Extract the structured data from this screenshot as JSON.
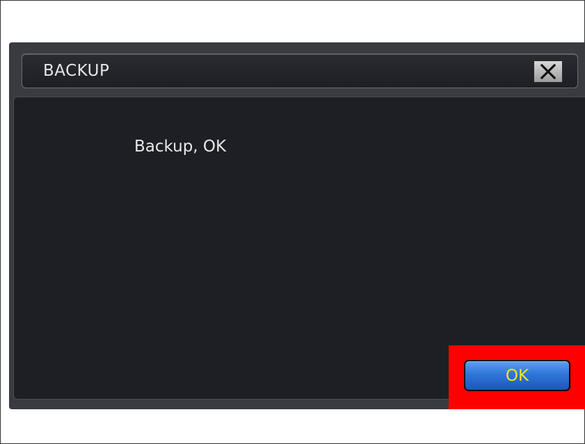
{
  "dialog": {
    "title": "BACKUP",
    "close_icon": "close-icon",
    "message": "Backup, OK",
    "ok_label": "OK"
  },
  "colors": {
    "dialog_background": "#1e1f24",
    "ok_button": "#2f76d9",
    "ok_text": "#f2e71a",
    "highlight": "#ff0000"
  }
}
